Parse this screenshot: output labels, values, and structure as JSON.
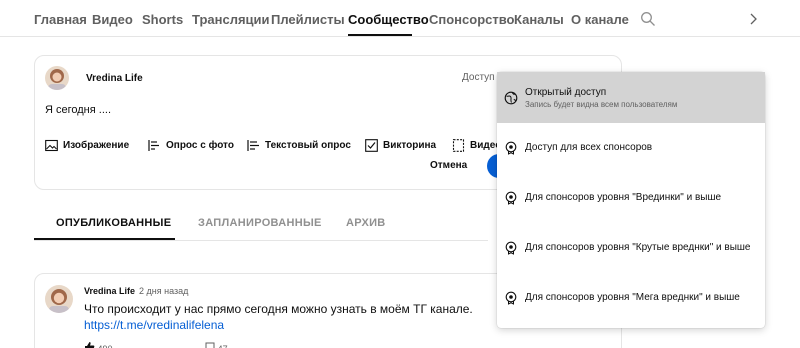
{
  "nav": {
    "tabs": [
      {
        "label": "Главная"
      },
      {
        "label": "Видео"
      },
      {
        "label": "Shorts"
      },
      {
        "label": "Трансляции"
      },
      {
        "label": "Плейлисты"
      },
      {
        "label": "Сообщество",
        "active": true
      },
      {
        "label": "Спонсорство"
      },
      {
        "label": "Каналы"
      },
      {
        "label": "О канале"
      }
    ],
    "search_icon": "search-icon",
    "next_icon": "chevron-right-icon"
  },
  "composer": {
    "channel_name": "Vredina Life",
    "access_label": "Доступ",
    "text": "Я сегодня ....",
    "tools": [
      {
        "label": "Изображение",
        "icon": "image-icon"
      },
      {
        "label": "Опрос с фото",
        "icon": "image-poll-icon"
      },
      {
        "label": "Текстовый опрос",
        "icon": "text-poll-icon"
      },
      {
        "label": "Викторина",
        "icon": "quiz-icon"
      },
      {
        "label": "Видео",
        "icon": "video-icon"
      }
    ],
    "cancel_label": "Отмена",
    "accent": "#065fd4"
  },
  "subtabs": [
    {
      "label": "ОПУБЛИКОВАННЫЕ",
      "active": true
    },
    {
      "label": "ЗАПЛАНИРОВАННЫЕ"
    },
    {
      "label": "АРХИВ"
    }
  ],
  "post": {
    "author": "Vredina Life",
    "time": "2 дня назад",
    "text": "Что происходит у нас прямо сегодня можно узнать в моём ТГ канале.",
    "link": "https://t.me/vredinalifelena",
    "likes": "490",
    "comments": "47"
  },
  "access_menu": {
    "items": [
      {
        "title": "Открытый доступ",
        "subtitle": "Запись будет видна всем пользователям",
        "icon": "globe-icon",
        "selected": true
      },
      {
        "title": "Доступ для всех спонсоров",
        "icon": "sponsor-badge-icon"
      },
      {
        "title": "Для спонсоров уровня \"Врединки\" и выше",
        "icon": "sponsor-badge-icon"
      },
      {
        "title": "Для спонсоров уровня \"Крутые вреднки\" и выше",
        "icon": "sponsor-badge-icon"
      },
      {
        "title": "Для спонсоров уровня \"Мега вреднки\" и выше",
        "icon": "sponsor-badge-icon"
      }
    ]
  }
}
